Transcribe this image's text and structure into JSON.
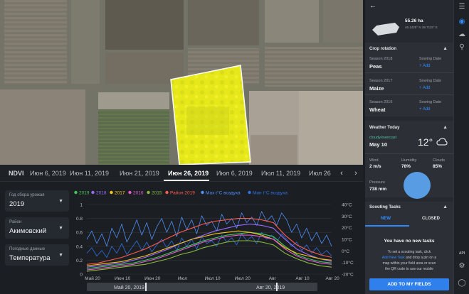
{
  "field": {
    "area": "55.26 ha",
    "coords": "45.1425° N 39.7115° E"
  },
  "crop_rotation": {
    "title": "Crop rotation",
    "sowing_label": "Sowing Date",
    "add_label": "+ Add",
    "seasons": [
      {
        "season": "Season 2018",
        "crop": "Peas"
      },
      {
        "season": "Season 2017",
        "crop": "Maize"
      },
      {
        "season": "Season 2016",
        "crop": "Wheat"
      }
    ]
  },
  "weather": {
    "title": "Weather Today",
    "condition": "cloudy/overcast",
    "date": "May 10",
    "temp": "12°",
    "wind_label": "Wind",
    "wind_value": "2 m/s",
    "humidity_label": "Humidity",
    "humidity_value": "78%",
    "clouds_label": "Clouds",
    "clouds_value": "85%",
    "pressure_label": "Pressure",
    "pressure_value": "738 mm"
  },
  "scouting": {
    "title": "Scouting Tasks",
    "tab_new": "NEW",
    "tab_closed": "CLOSED",
    "empty_title": "You have no new tasks",
    "desc_1": "To set a scouting task, click",
    "desc_2_link": "Add New Task",
    "desc_2_rest": " and drop a pin on a",
    "desc_3": "map within your field area or scan",
    "desc_4": "the QR code to use our mobile"
  },
  "buttons": {
    "add_to_fields": "ADD TO MY FIELDS"
  },
  "rail": {
    "api_label": "API"
  },
  "dates": {
    "ndvi_label": "NDVI",
    "tabs": [
      "Июн 6, 2019",
      "Июн 11, 2019",
      "Июн 21, 2019",
      "Июн 26, 2019",
      "Июл 6, 2019",
      "Июл 11, 2019",
      "Июл 26"
    ],
    "active_index": 3
  },
  "controls": {
    "year_label": "Год сбора урожая",
    "year_value": "2019",
    "district_label": "Район",
    "district_value": "Акимовский",
    "weather_label": "Погодные данные",
    "weather_value": "Температура"
  },
  "timeline": {
    "start": "Май 20, 2019",
    "end": "Авг 20, 2019"
  },
  "colors": {
    "accent": "#2f80ed",
    "ndvi_yellow": "#e8ea12"
  },
  "chart_data": {
    "type": "line",
    "legend": [
      "2019",
      "2018",
      "2017",
      "2016",
      "2015",
      "Район 2019",
      "Мах t°C воздуха",
      "Мин t°C воздуха"
    ],
    "legend_colors": [
      "#42c85a",
      "#9b6bff",
      "#f5c518",
      "#e55bd0",
      "#8ab83c",
      "#ff5a4e",
      "#4f8ff7",
      "#2f6fe0"
    ],
    "x_ticks": [
      "Май 20",
      "Июн 10",
      "Июн 20",
      "Июл",
      "Июл 10",
      "Июл 20",
      "Авг",
      "Авг 10",
      "Авг 20"
    ],
    "y_ticks": [
      "1",
      "0.8",
      "0.6",
      "0.4",
      "0.2",
      "0"
    ],
    "y_ticks_right": [
      "40°C",
      "30°C",
      "20°C",
      "10°C",
      "0°C",
      "-10°C",
      "-20°C"
    ],
    "ylim": [
      0,
      1
    ],
    "y2lim": [
      -20,
      40
    ],
    "grid": true,
    "series": [
      {
        "index": 0,
        "values": [
          0.08,
          0.1,
          0.12,
          0.14,
          0.16,
          0.2,
          0.24,
          0.3,
          0.36,
          0.42,
          0.48,
          0.52,
          0.56,
          0.58,
          0.6,
          0.58,
          0.54,
          0.4,
          0.28,
          0.22,
          0.18,
          0.16
        ]
      },
      {
        "index": 1,
        "values": [
          0.1,
          0.12,
          0.14,
          0.16,
          0.2,
          0.24,
          0.3,
          0.36,
          0.44,
          0.5,
          0.56,
          0.62,
          0.66,
          0.7,
          0.72,
          0.7,
          0.66,
          0.5,
          0.36,
          0.28,
          0.22,
          0.18
        ]
      },
      {
        "index": 2,
        "values": [
          0.12,
          0.14,
          0.16,
          0.18,
          0.22,
          0.26,
          0.32,
          0.38,
          0.44,
          0.5,
          0.54,
          0.58,
          0.6,
          0.62,
          0.6,
          0.56,
          0.5,
          0.38,
          0.3,
          0.26,
          0.22,
          0.2
        ]
      },
      {
        "index": 3,
        "values": [
          0.06,
          0.08,
          0.1,
          0.12,
          0.14,
          0.18,
          0.22,
          0.28,
          0.34,
          0.4,
          0.46,
          0.5,
          0.54,
          0.56,
          0.56,
          0.54,
          0.5,
          0.36,
          0.26,
          0.2,
          0.16,
          0.14
        ]
      },
      {
        "index": 4,
        "values": [
          0.04,
          0.06,
          0.08,
          0.1,
          0.12,
          0.14,
          0.18,
          0.22,
          0.28,
          0.32,
          0.38,
          0.42,
          0.46,
          0.48,
          0.48,
          0.46,
          0.42,
          0.3,
          0.22,
          0.16,
          0.12,
          0.1
        ]
      },
      {
        "index": 5,
        "values": [
          0.14,
          0.16,
          0.2,
          0.24,
          0.3,
          0.36,
          0.44,
          0.52,
          0.6,
          0.66,
          0.72,
          0.76,
          0.78,
          0.8,
          0.8,
          0.78,
          0.74,
          0.56,
          0.42,
          0.34,
          0.28,
          0.24
        ]
      }
    ],
    "max_temp_values": [
      0.5,
      0.62,
      0.44,
      0.58,
      0.4,
      0.66,
      0.52,
      0.72,
      0.46,
      0.6,
      0.78,
      0.56,
      0.74,
      0.5,
      0.68,
      0.8,
      0.6,
      0.76,
      0.54,
      0.82,
      0.64,
      0.78,
      0.58,
      0.84,
      0.7,
      0.76,
      0.62,
      0.86,
      0.72,
      0.8,
      0.66,
      0.88,
      0.74,
      0.82,
      0.7,
      0.9,
      0.76,
      0.84,
      0.7,
      0.88,
      0.78,
      0.6,
      0.72,
      0.52,
      0.66,
      0.48,
      0.6,
      0.44,
      0.56,
      0.4
    ],
    "min_temp_values": [
      0.3,
      0.38,
      0.26,
      0.34,
      0.24,
      0.4,
      0.3,
      0.44,
      0.28,
      0.38,
      0.48,
      0.34,
      0.46,
      0.32,
      0.42,
      0.5,
      0.38,
      0.48,
      0.34,
      0.52,
      0.4,
      0.5,
      0.36,
      0.54,
      0.44,
      0.48,
      0.4,
      0.56,
      0.46,
      0.52,
      0.42,
      0.58,
      0.48,
      0.54,
      0.44,
      0.6,
      0.5,
      0.56,
      0.46,
      0.58,
      0.5,
      0.4,
      0.46,
      0.34,
      0.42,
      0.3,
      0.38,
      0.28,
      0.34,
      0.26
    ]
  }
}
